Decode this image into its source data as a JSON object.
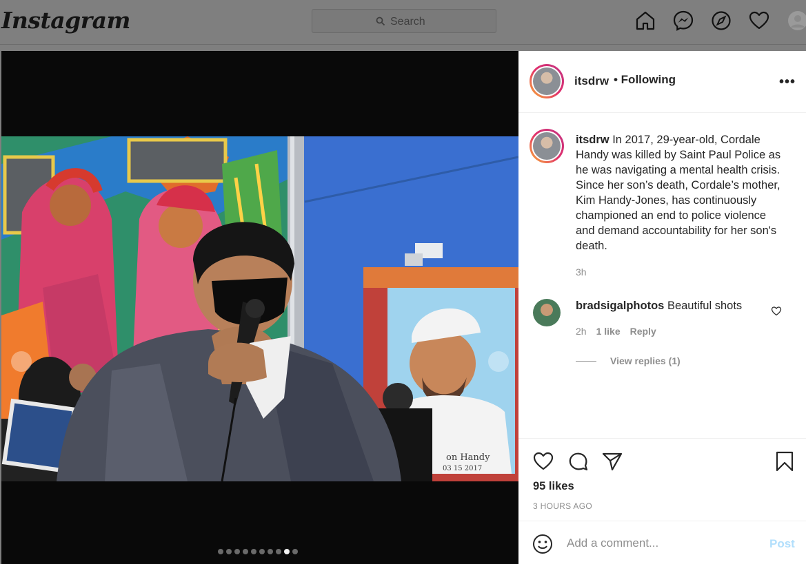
{
  "nav": {
    "logo": "Instagram",
    "search_placeholder": "Search",
    "icons": [
      "home-icon",
      "messenger-icon",
      "explore-icon",
      "activity-heart-icon",
      "profile-avatar"
    ]
  },
  "media": {
    "carousel_count": 10,
    "active_index": 8,
    "photo_text": "on Handy",
    "photo_date": "03 15 2017"
  },
  "post": {
    "username": "itsdrw",
    "following_label": "• Following",
    "more_label": "•••"
  },
  "caption": {
    "username": "itsdrw",
    "text": "In 2017, 29-year-old, Cordale Handy was killed by Saint Paul Police as he was navigating a mental health crisis. Since her son’s death, Cordale’s mother, Kim Handy-Jones, has continuously championed an end to police violence and demand accountability for her son's death.",
    "time": "3h"
  },
  "comments": [
    {
      "username": "bradsigalphotos",
      "text": "Beautiful shots",
      "time": "2h",
      "likes": "1 like",
      "reply_label": "Reply",
      "view_replies": "View replies (1)"
    }
  ],
  "footer": {
    "likes": "95 likes",
    "timestamp": "3 HOURS AGO",
    "comment_placeholder": "Add a comment...",
    "post_label": "Post"
  },
  "colors": {
    "accent_post_disabled": "#b2dffc",
    "secondary_text": "#8e8e8e"
  }
}
